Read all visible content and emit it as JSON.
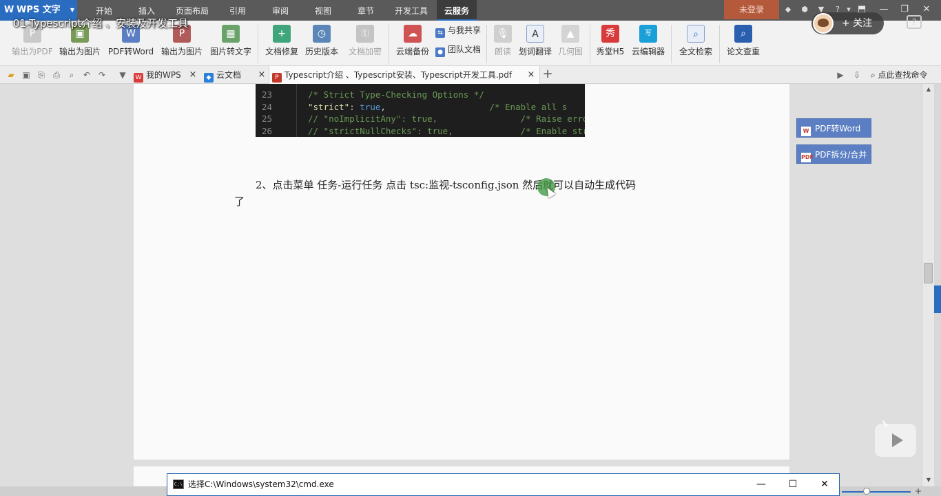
{
  "app": {
    "logo_label": "WPS 文字"
  },
  "menu": {
    "tabs": [
      "开始",
      "插入",
      "页面布局",
      "引用",
      "审阅",
      "视图",
      "章节",
      "开发工具",
      "云服务"
    ],
    "active_tab": "云服务",
    "login_label": "未登录"
  },
  "overlay": {
    "video_title": "01-Typescript介绍 、安装及开发工具",
    "follow_label": "+ 关注",
    "help_label": "?"
  },
  "ribbon": {
    "buttons": [
      {
        "label": "输出为PDF",
        "icon": "export-pdf-icon",
        "disabled": true
      },
      {
        "label": "输出为图片",
        "icon": "export-image-icon",
        "disabled": false
      },
      {
        "label": "PDF转Word",
        "icon": "pdf-to-word-icon",
        "disabled": false
      },
      {
        "label": "输出为图片",
        "icon": "export-image-icon",
        "disabled": false
      },
      {
        "label": "图片转文字",
        "icon": "image-to-text-icon",
        "disabled": false
      },
      {
        "label": "文档修复",
        "icon": "doc-repair-icon",
        "disabled": false
      },
      {
        "label": "历史版本",
        "icon": "history-icon",
        "disabled": false
      },
      {
        "label": "文档加密",
        "icon": "encrypt-icon",
        "disabled": true
      },
      {
        "label": "云端备份",
        "icon": "cloud-backup-icon",
        "disabled": false
      },
      {
        "label": "朗读",
        "icon": "microphone-icon",
        "disabled": true
      },
      {
        "label": "划词翻译",
        "icon": "translate-icon",
        "disabled": false
      },
      {
        "label": "几何图",
        "icon": "geometry-icon",
        "disabled": true
      },
      {
        "label": "秀堂H5",
        "icon": "xiutang-icon",
        "disabled": false
      },
      {
        "label": "云编辑器",
        "icon": "cloud-editor-icon",
        "disabled": false
      },
      {
        "label": "全文检索",
        "icon": "fulltext-search-icon",
        "disabled": false
      },
      {
        "label": "论文查重",
        "icon": "plagiarism-check-icon",
        "disabled": false
      }
    ],
    "share_with_me": "与我共享",
    "team_docs": "团队文档"
  },
  "tabs_bar": {
    "tabs": [
      {
        "label": "我的WPS"
      },
      {
        "label": "云文档"
      },
      {
        "label": "Typescript介绍 、Typescript安装、Typescript开发工具.pdf"
      }
    ],
    "close_label": "×",
    "new_tab": "+",
    "find_command": "点此查找命令"
  },
  "document": {
    "code_lines": [
      {
        "num": "23",
        "parts": [
          [
            "comment",
            "/* Strict Type-Checking Options */"
          ]
        ]
      },
      {
        "num": "24",
        "parts": [
          [
            "key",
            "\"strict\""
          ],
          [
            "plain",
            ": "
          ],
          [
            "kw",
            "true"
          ],
          [
            "plain",
            ",                    "
          ],
          [
            "comment",
            "/* Enable all s"
          ]
        ]
      },
      {
        "num": "25",
        "parts": [
          [
            "comment",
            "// \"noImplicitAny\": true,                /* Raise error"
          ]
        ]
      },
      {
        "num": "26",
        "parts": [
          [
            "comment",
            "// \"strictNullChecks\": true,             /* Enable stric"
          ]
        ]
      }
    ],
    "line1": "2、点击菜单  任务-运行任务     点击 tsc:监视-tsconfig.json  然后就可以自动生成代码",
    "line2": "了"
  },
  "side_panel": {
    "pdf_to_word": "PDF转Word",
    "pdf_split_merge": "PDF拆分/合并"
  },
  "cmd_window": {
    "title": "选择C:\\Windows\\system32\\cmd.exe",
    "minimize": "—",
    "maximize": "☐",
    "close": "✕"
  },
  "colors": {
    "wps_blue": "#2a6cbf",
    "login_orange": "#b4593b",
    "side_button": "#5b7fc2"
  }
}
